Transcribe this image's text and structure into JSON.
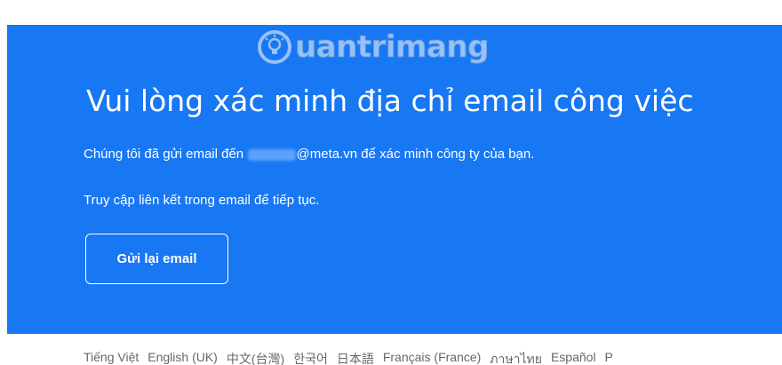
{
  "watermark": {
    "text": "uantrimang"
  },
  "main": {
    "title": "Vui lòng xác minh địa chỉ email công việc",
    "sent_prefix": "Chúng tôi đã gửi email đến",
    "email_redacted": "minhtrang",
    "email_domain": "@meta.vn",
    "sent_suffix": " để xác minh công ty của bạn.",
    "instruction": "Truy cập liên kết trong email để tiếp tục.",
    "resend_label": "Gửi lại email"
  },
  "languages": [
    "Tiếng Việt",
    "English (UK)",
    "中文(台灣)",
    "한국어",
    "日本語",
    "Français (France)",
    "ภาษาไทย",
    "Español",
    "P"
  ],
  "colors": {
    "hero_background": "#1877f2",
    "text_on_hero": "#ffffff",
    "footer_text": "#65676b"
  }
}
